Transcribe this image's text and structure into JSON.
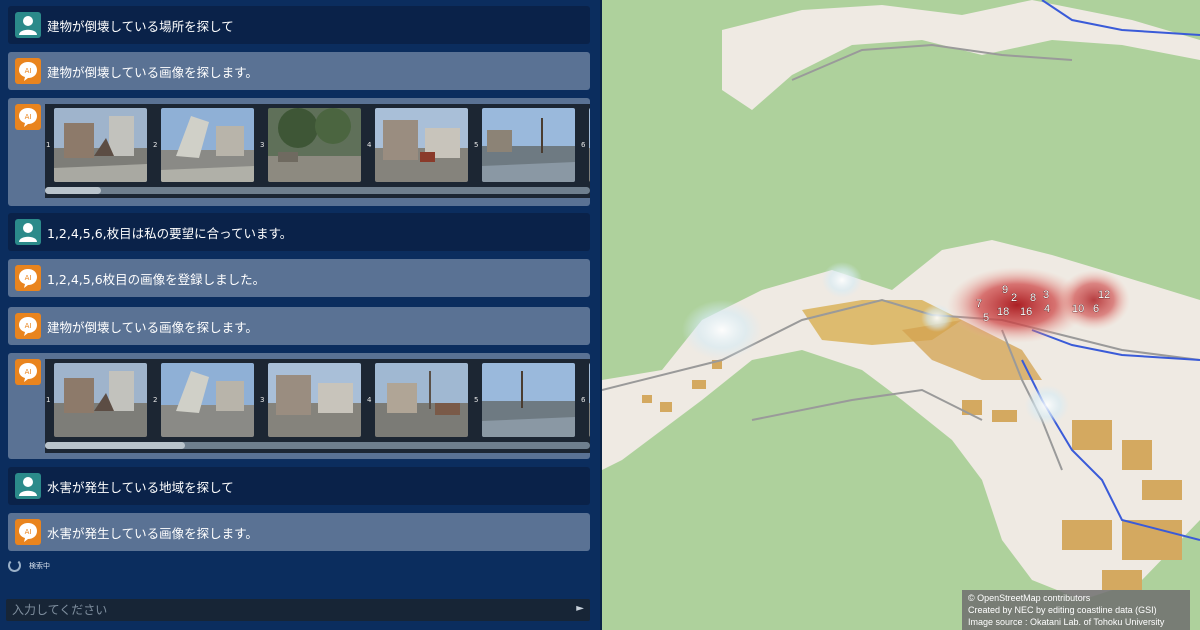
{
  "chat": {
    "messages": [
      {
        "role": "user",
        "text": "建物が倒壊している場所を探して"
      },
      {
        "role": "ai",
        "text": "建物が倒壊している画像を探します。"
      },
      {
        "role": "ai",
        "type": "gallery",
        "numbers": [
          "1",
          "2",
          "3",
          "4",
          "5",
          "6"
        ]
      },
      {
        "role": "user",
        "text": "1,2,4,5,6,枚目は私の要望に合っています。"
      },
      {
        "role": "ai",
        "text": "1,2,4,5,6枚目の画像を登録しました。"
      },
      {
        "role": "ai",
        "text": "建物が倒壊している画像を探します。"
      },
      {
        "role": "ai",
        "type": "gallery",
        "numbers": [
          "1",
          "2",
          "3",
          "4",
          "5",
          "6"
        ]
      },
      {
        "role": "user",
        "text": "水害が発生している地域を探して"
      },
      {
        "role": "ai",
        "text": "水害が発生している画像を探します。"
      }
    ],
    "avatar_ai_label": "AI",
    "status_text": "検索中",
    "input_placeholder": "入力してください",
    "send_icon": "send-icon"
  },
  "map": {
    "markers": [
      "9",
      "2",
      "8",
      "3",
      "7",
      "5",
      "18",
      "16",
      "4",
      "10",
      "6",
      "12"
    ],
    "attribution": [
      "© OpenStreetMap contributors",
      "Created by NEC by editing coastline data (GSI)",
      "Image source : Okatani Lab. of  Tohoku University"
    ]
  },
  "colors": {
    "chat_bg": "#0b2d5e",
    "user_bubble": "#0a2249",
    "ai_bubble": "#5a7294",
    "user_avatar": "#2b8a8a",
    "ai_avatar": "#e9841e",
    "land": "#aed19c",
    "settlement": "#efeae3",
    "buildings": "#d4a960",
    "river": "#3a5bd8",
    "heat": "#b2191b"
  }
}
